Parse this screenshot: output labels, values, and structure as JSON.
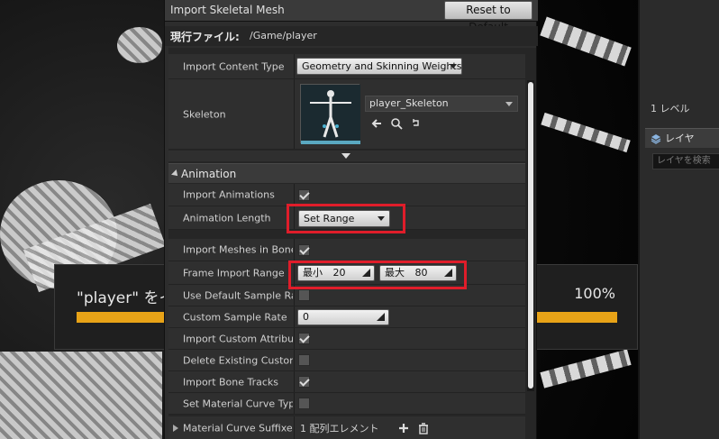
{
  "dialog": {
    "title": "Import Skeletal Mesh",
    "reset_button": "Reset to Default",
    "path_label": "現行ファイル:",
    "path_value": "/Game/player"
  },
  "mesh": {
    "import_content_type": {
      "label": "Import Content Type",
      "value": "Geometry and Skinning Weights."
    },
    "skeleton": {
      "label": "Skeleton",
      "value": "player_Skeleton"
    }
  },
  "animation": {
    "section_title": "Animation",
    "rows": {
      "import_animations": {
        "label": "Import Animations",
        "checked": true
      },
      "animation_length": {
        "label": "Animation Length",
        "value": "Set Range"
      },
      "import_meshes_in_bone_hierarchy": {
        "label": "Import Meshes in Bone H",
        "checked": true
      },
      "frame_import_range": {
        "label": "Frame Import Range",
        "min_label": "最小",
        "min_value": "20",
        "max_label": "最大",
        "max_value": "80"
      },
      "use_default_sample_rate": {
        "label": "Use Default Sample Rate",
        "checked": false
      },
      "custom_sample_rate": {
        "label": "Custom Sample Rate",
        "value": "0"
      },
      "import_custom_attribute": {
        "label": "Import Custom Attribute",
        "checked": true
      },
      "delete_existing_custom": {
        "label": "Delete Existing Custom A",
        "checked": false
      },
      "import_bone_tracks": {
        "label": "Import Bone Tracks",
        "checked": true
      },
      "set_material_curve_type": {
        "label": "Set Material Curve Type",
        "checked": false
      },
      "material_curve_suffixes": {
        "label": "Material Curve Suffixes",
        "value": "1 配列エレメント"
      }
    }
  },
  "progress": {
    "title": "\"player\" をイ",
    "percent_text": "100%",
    "percent": 1.0
  },
  "right_panel": {
    "level_text": "1 レベル",
    "layer_tab": "レイヤ",
    "layer_search_placeholder": "レイヤを検索"
  },
  "colors": {
    "highlight": "#e01d2a",
    "progress_fill": "#e8a317"
  }
}
